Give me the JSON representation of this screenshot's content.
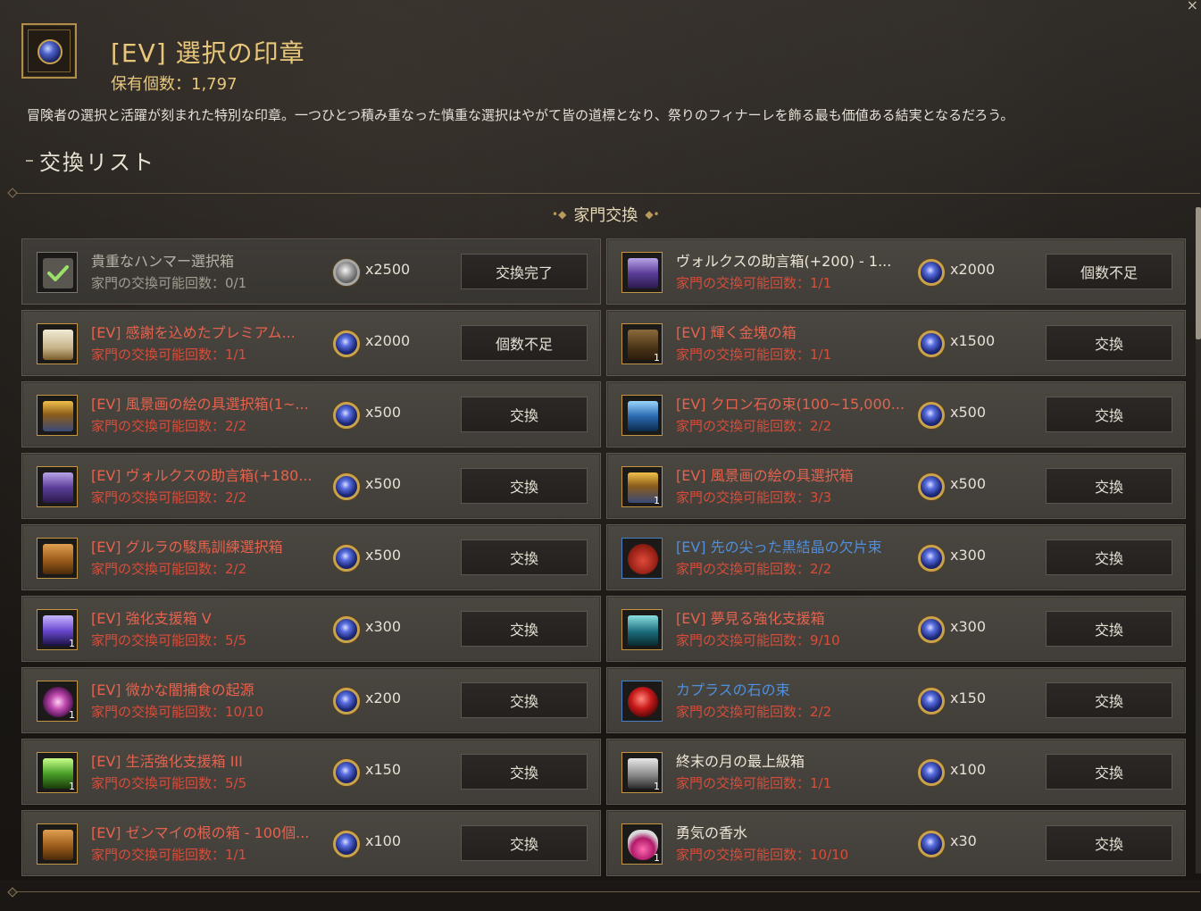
{
  "header": {
    "title": "[EV] 選択の印章",
    "owned": "保有個数：1,797",
    "description": "冒険者の選択と活躍が刻まれた特別な印章。一つひとつ積み重なった慎重な選択はやがて皆の道標となり、祭りのフィナーレを飾る最も価値ある結実となるだろう。",
    "close_icon": "×"
  },
  "section": {
    "title": "交換リスト",
    "subtitle": "家門交換"
  },
  "colors": {
    "gold": "#e9c77a",
    "limit_red": "#d94d3a",
    "name_red": "#e4634e",
    "name_blue": "#4f8fdd"
  },
  "items": [
    {
      "name": "貴重なハンマー選択箱",
      "limit": "家門の交換可能回数：0/1",
      "cost": "x2500",
      "button": "交換完了",
      "icon": "check-icon",
      "name_color": "gray",
      "currency": "silver",
      "done": true
    },
    {
      "name": "ヴォルクスの助言箱(+200) - 1...",
      "limit": "家門の交換可能回数：1/1",
      "cost": "x2000",
      "button": "個数不足",
      "icon": "purple-chest-icon",
      "name_color": "gold"
    },
    {
      "name": "[EV] 感謝を込めたプレミアム...",
      "limit": "家門の交換可能回数：1/1",
      "cost": "x2000",
      "button": "個数不足",
      "icon": "premium-box-icon",
      "name_color": "red"
    },
    {
      "name": "[EV] 輝く金塊の箱",
      "limit": "家門の交換可能回数：1/1",
      "cost": "x1500",
      "button": "交換",
      "icon": "gold-bar-box-icon",
      "name_color": "red",
      "qty": "1"
    },
    {
      "name": "[EV] 風景画の絵の具選択箱(1~...",
      "limit": "家門の交換可能回数：2/2",
      "cost": "x500",
      "button": "交換",
      "icon": "paint-box-icon",
      "name_color": "red"
    },
    {
      "name": "[EV] クロン石の束(100~15,000...",
      "limit": "家門の交換可能回数：2/2",
      "cost": "x500",
      "button": "交換",
      "icon": "cron-stone-chest-icon",
      "name_color": "red"
    },
    {
      "name": "[EV] ヴォルクスの助言箱(+180...",
      "limit": "家門の交換可能回数：2/2",
      "cost": "x500",
      "button": "交換",
      "icon": "purple-chest-icon",
      "name_color": "red"
    },
    {
      "name": "[EV] 風景画の絵の具選択箱",
      "limit": "家門の交換可能回数：3/3",
      "cost": "x500",
      "button": "交換",
      "icon": "paint-box-icon",
      "name_color": "red",
      "qty": "1"
    },
    {
      "name": "[EV] グルラの駿馬訓練選択箱",
      "limit": "家門の交換可能回数：2/2",
      "cost": "x500",
      "button": "交換",
      "icon": "wooden-chest-icon",
      "name_color": "red"
    },
    {
      "name": "[EV] 先の尖った黒結晶の欠片束",
      "limit": "家門の交換可能回数：2/2",
      "cost": "x300",
      "button": "交換",
      "icon": "red-pouch-icon",
      "name_color": "blue",
      "border": "blue"
    },
    {
      "name": "[EV] 強化支援箱 V",
      "limit": "家門の交換可能回数：5/5",
      "cost": "x300",
      "button": "交換",
      "icon": "purple-cube-icon",
      "name_color": "red",
      "qty": "1"
    },
    {
      "name": "[EV] 夢見る強化支援箱",
      "limit": "家門の交換可能回数：9/10",
      "cost": "x300",
      "button": "交換",
      "icon": "teal-chest-icon",
      "name_color": "red"
    },
    {
      "name": "[EV] 微かな闇捕食の起源",
      "limit": "家門の交換可能回数：10/10",
      "cost": "x200",
      "button": "交換",
      "icon": "dark-swirl-icon",
      "name_color": "red",
      "qty": "1"
    },
    {
      "name": "カプラスの石の束",
      "limit": "家門の交換可能回数：2/2",
      "cost": "x150",
      "button": "交換",
      "icon": "red-orb-icon",
      "name_color": "blue",
      "border": "blue"
    },
    {
      "name": "[EV] 生活強化支援箱 III",
      "limit": "家門の交換可能回数：5/5",
      "cost": "x150",
      "button": "交換",
      "icon": "green-cube-icon",
      "name_color": "red",
      "qty": "1"
    },
    {
      "name": "終末の月の最上級箱",
      "limit": "家門の交換可能回数：1/1",
      "cost": "x100",
      "button": "交換",
      "icon": "silver-chest-icon",
      "name_color": "gold",
      "qty": "1"
    },
    {
      "name": "[EV] ゼンマイの根の箱 - 100個...",
      "limit": "家門の交換可能回数：1/1",
      "cost": "x100",
      "button": "交換",
      "icon": "wooden-chest-icon",
      "name_color": "red"
    },
    {
      "name": "勇気の香水",
      "limit": "家門の交換可能回数：10/10",
      "cost": "x30",
      "button": "交換",
      "icon": "perfume-bottle-icon",
      "name_color": "gold",
      "qty": "1"
    }
  ]
}
